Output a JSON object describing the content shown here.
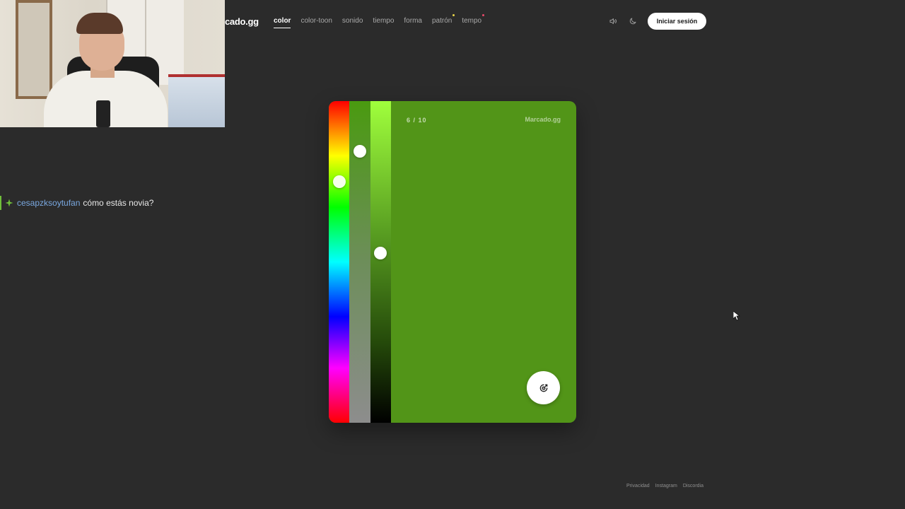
{
  "header": {
    "brand": "cado.gg",
    "nav": [
      {
        "label": "color",
        "active": true
      },
      {
        "label": "color-toon",
        "active": false
      },
      {
        "label": "sonido",
        "active": false
      },
      {
        "label": "tiempo",
        "active": false
      },
      {
        "label": "forma",
        "active": false
      },
      {
        "label": "patrón",
        "active": false,
        "dot_color": "#e8d44a"
      },
      {
        "label": "tempo",
        "active": false,
        "dot_color": "#e84a6a"
      }
    ],
    "icons": [
      "speaker-icon",
      "moon-icon"
    ],
    "login_label": "Iniciar sesión"
  },
  "chat": {
    "badge_icon": "sparkle-icon",
    "badge_color": "#6fbf3a",
    "username": "cesapzksoytufan",
    "message": "cómo estás novia?"
  },
  "game": {
    "round_label": "6 / 10",
    "card_brand": "Marcado.gg",
    "current_color": "#529518",
    "submit_icon": "target-arrow-icon"
  },
  "footer": {
    "links": [
      "Privacidad",
      "Instagram",
      "Discordia"
    ]
  }
}
